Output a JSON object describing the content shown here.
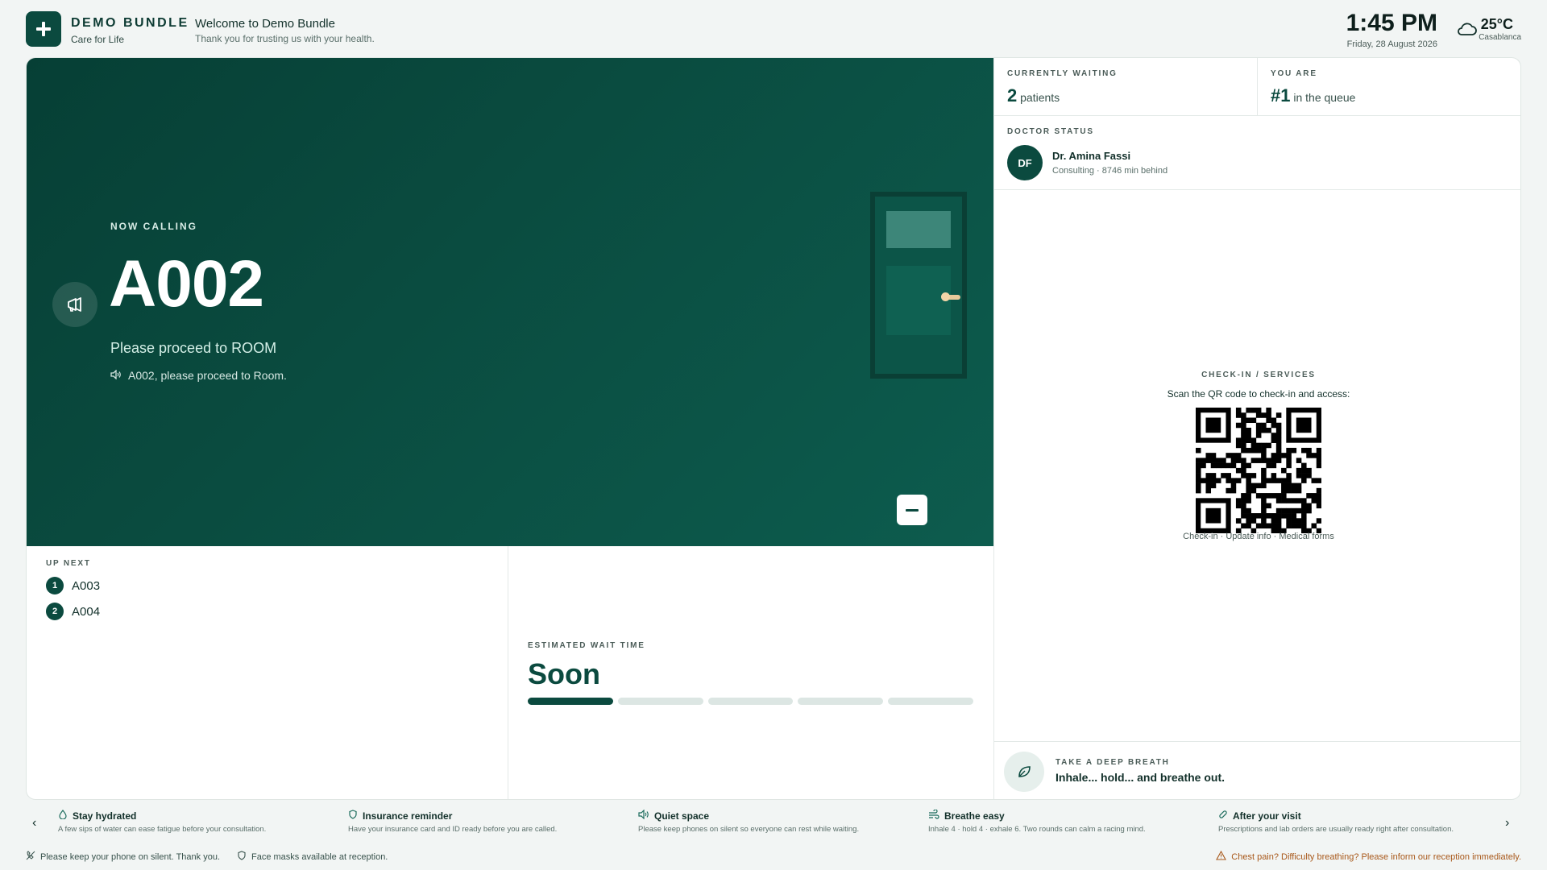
{
  "header": {
    "brand_name": "DEMO BUNDLE",
    "brand_tagline": "Care for Life",
    "welcome_title": "Welcome to Demo Bundle",
    "welcome_subtitle": "Thank you for trusting us with your health.",
    "time": "1:45 PM",
    "date": "Friday, 28 August 2026",
    "temperature": "25°C",
    "city": "Casablanca",
    "weather_icon": "cloud-icon"
  },
  "hero": {
    "label": "NOW CALLING",
    "number": "A002",
    "room_text": "Please proceed to ROOM",
    "audio_text": "A002, please proceed to Room."
  },
  "up_next": {
    "label": "UP NEXT",
    "items": [
      {
        "position": "1",
        "ticket": "A003"
      },
      {
        "position": "2",
        "ticket": "A004"
      }
    ]
  },
  "wait": {
    "label": "ESTIMATED WAIT TIME",
    "value": "Soon",
    "level_segments_filled": 1,
    "level_segments_total": 5
  },
  "stats": {
    "waiting_label": "CURRENTLY WAITING",
    "waiting_count": "2",
    "waiting_unit": "patients",
    "position_label": "YOU ARE",
    "position_value": "#1",
    "position_unit": "in the queue"
  },
  "doctor": {
    "label": "DOCTOR STATUS",
    "initials": "DF",
    "name": "Dr. Amina Fassi",
    "status": "Consulting · 8746 min behind"
  },
  "checkin": {
    "label": "CHECK-IN / SERVICES",
    "subtitle": "Scan the QR code to check-in and access:",
    "links": "Check-in · Update info · Medical forms"
  },
  "breath": {
    "label": "TAKE A DEEP BREATH",
    "text": "Inhale... hold... and breathe out."
  },
  "tips": [
    {
      "icon": "water-drop-icon",
      "title": "Stay hydrated",
      "text": "A few sips of water can ease fatigue before your consultation."
    },
    {
      "icon": "shield-icon",
      "title": "Insurance reminder",
      "text": "Have your insurance card and ID ready before you are called."
    },
    {
      "icon": "speaker-icon",
      "title": "Quiet space",
      "text": "Please keep phones on silent so everyone can rest while waiting."
    },
    {
      "icon": "wind-icon",
      "title": "Breathe easy",
      "text": "Inhale 4 · hold 4 · exhale 6. Two rounds can calm a racing mind."
    },
    {
      "icon": "pill-icon",
      "title": "After your visit",
      "text": "Prescriptions and lab orders are usually ready right after consultation."
    }
  ],
  "footer": {
    "phone_notice": "Please keep your phone on silent. Thank you.",
    "mask_notice": "Face masks available at reception.",
    "emergency_notice": "Chest pain? Difficulty breathing? Please inform our reception immediately."
  },
  "colors": {
    "primary": "#0b4a3f",
    "background": "#f2f5f4",
    "warning": "#a8581a"
  }
}
